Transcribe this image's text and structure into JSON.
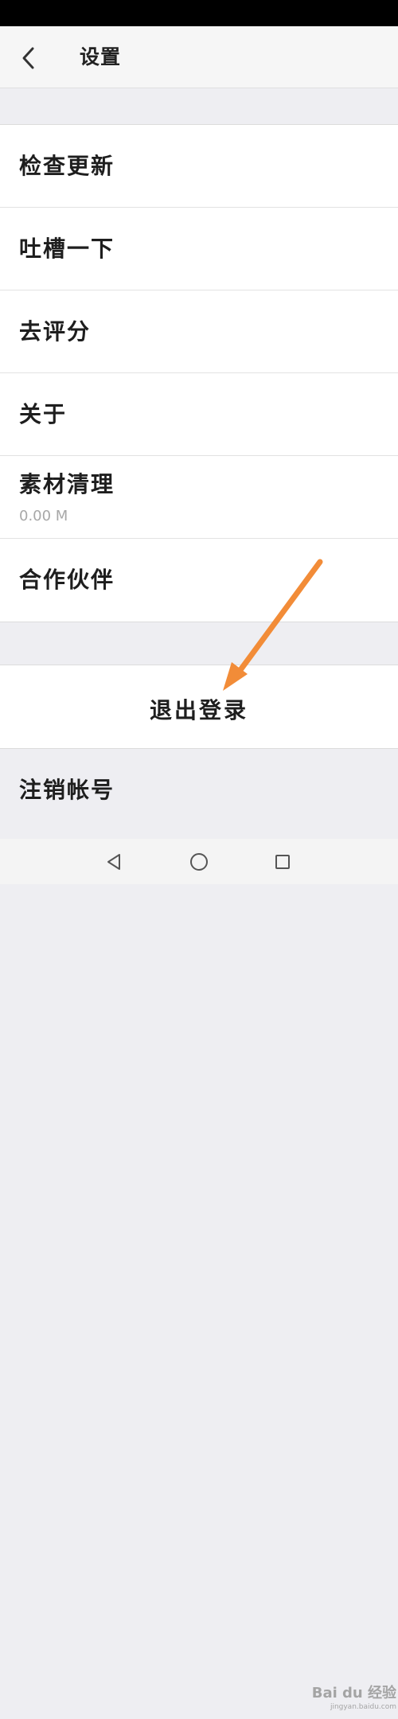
{
  "header": {
    "title": "设置",
    "back_icon": "chevron-left-icon"
  },
  "settings": {
    "items": [
      {
        "label": "检查更新",
        "sub": ""
      },
      {
        "label": "吐槽一下",
        "sub": ""
      },
      {
        "label": "去评分",
        "sub": ""
      },
      {
        "label": "关于",
        "sub": ""
      },
      {
        "label": "素材清理",
        "sub": "0.00 M"
      },
      {
        "label": "合作伙伴",
        "sub": ""
      }
    ]
  },
  "logout": {
    "label": "退出登录"
  },
  "cancel_account": {
    "label": "注销帐号"
  },
  "nav_bar": {
    "back_icon": "triangle-back-icon",
    "home_icon": "circle-home-icon",
    "recents_icon": "square-recents-icon"
  },
  "annotation": {
    "arrow_color": "#f28c38"
  },
  "watermark": {
    "text": "Bai du 经验",
    "sub": "jingyan.baidu.com"
  }
}
